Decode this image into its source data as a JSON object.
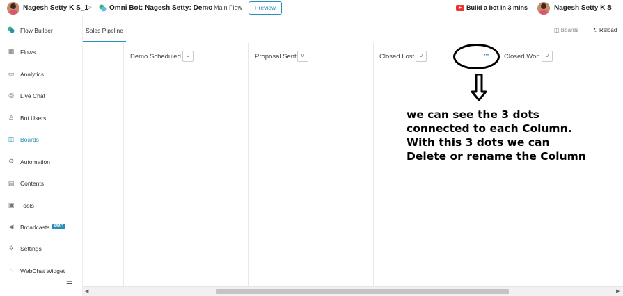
{
  "topbar": {
    "user_name": "Nagesh Setty K S_1",
    "bot_name": "Omni Bot: Nagesh Setty: Demo",
    "flow_name": "Main Flow",
    "preview_label": "Preview",
    "build_bot_label": "Build a bot in 3 mins",
    "account_name": "Nagesh Setty K S"
  },
  "sidebar": {
    "items": [
      {
        "label": "Flow Builder",
        "icon": "flow-builder-icon"
      },
      {
        "label": "Flows",
        "icon": "grid-icon"
      },
      {
        "label": "Analytics",
        "icon": "analytics-icon"
      },
      {
        "label": "Live Chat",
        "icon": "headset-icon"
      },
      {
        "label": "Bot Users",
        "icon": "user-icon"
      },
      {
        "label": "Boards",
        "icon": "boards-icon"
      },
      {
        "label": "Automation",
        "icon": "automation-icon"
      },
      {
        "label": "Contents",
        "icon": "contents-icon"
      },
      {
        "label": "Tools",
        "icon": "tools-icon"
      },
      {
        "label": "Broadcasts",
        "icon": "megaphone-icon",
        "badge": "PRO"
      },
      {
        "label": "Settings",
        "icon": "gear-icon"
      },
      {
        "label": "WebChat Widget",
        "icon": "chat-icon"
      }
    ],
    "active_index": 5
  },
  "subheader": {
    "tab_label": "Sales Pipeline",
    "boards_label": "Boards",
    "reload_label": "Reload"
  },
  "board": {
    "columns": [
      {
        "title": "Demo Scheduled",
        "count": "0"
      },
      {
        "title": "Proposal Sent",
        "count": "0"
      },
      {
        "title": "Closed Lost",
        "count": "0"
      },
      {
        "title": "Closed Won",
        "count": "0"
      }
    ],
    "menu_dots": "···"
  },
  "annotation": {
    "lines": [
      "we can see the 3 dots",
      "connected to each Column.",
      "With this 3 dots we can",
      "Delete or rename the Column"
    ]
  },
  "colors": {
    "accent": "#2a8fb8",
    "pro_badge": "#2a8fb8",
    "youtube": "#e33333"
  }
}
